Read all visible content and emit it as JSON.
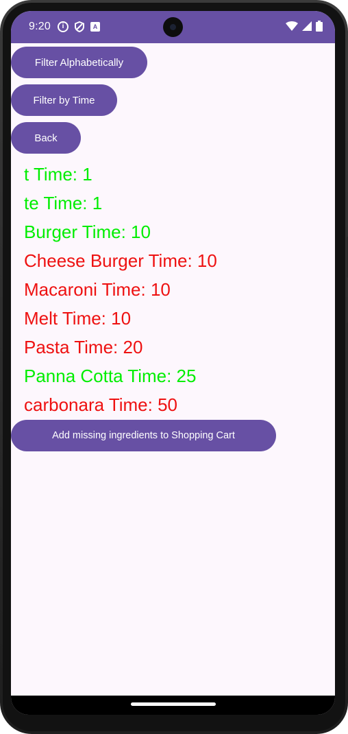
{
  "status_bar": {
    "time": "9:20",
    "background": "#6750a4",
    "icons_left": [
      "info-icon",
      "shield-icon",
      "font-a-icon"
    ],
    "icons_right": [
      "wifi-icon",
      "cell-signal-icon",
      "battery-icon"
    ]
  },
  "buttons": {
    "filter_alpha": "Filter Alphabetically",
    "filter_time": "Filter by Time",
    "back": "Back",
    "add_missing": "Add missing ingredients to Shopping Cart"
  },
  "colors": {
    "primary": "#6750a4",
    "available": "#00ee00",
    "missing": "#ee1111",
    "background": "#fdf7fd"
  },
  "recipes": [
    {
      "text": "t Time: 1",
      "color": "#00ee00"
    },
    {
      "text": "te Time: 1",
      "color": "#00ee00"
    },
    {
      "text": "Burger Time: 10",
      "color": "#00ee00"
    },
    {
      "text": "Cheese Burger Time: 10",
      "color": "#ee1111"
    },
    {
      "text": "Macaroni Time: 10",
      "color": "#ee1111"
    },
    {
      "text": "Melt Time: 10",
      "color": "#ee1111"
    },
    {
      "text": "Pasta Time: 20",
      "color": "#ee1111"
    },
    {
      "text": "Panna Cotta Time: 25",
      "color": "#00ee00"
    },
    {
      "text": "carbonara Time: 50",
      "color": "#ee1111"
    }
  ]
}
